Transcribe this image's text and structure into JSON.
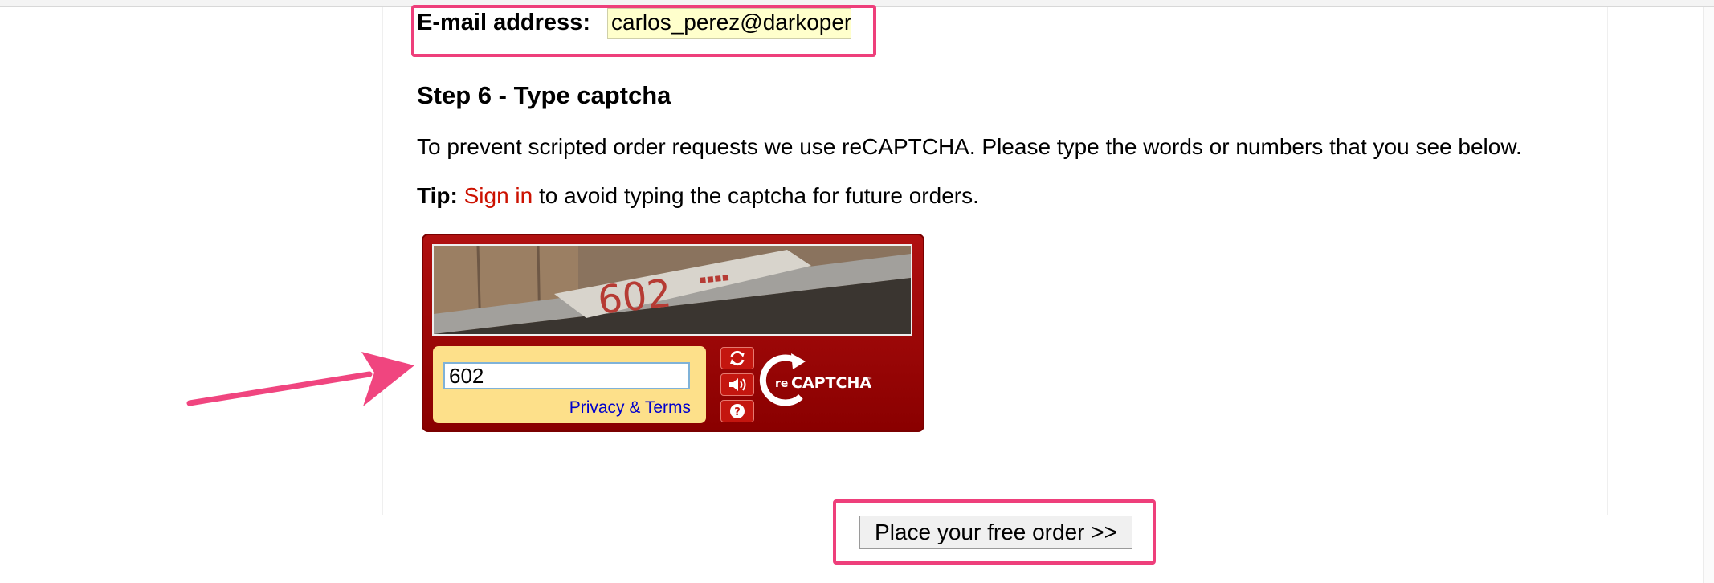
{
  "form": {
    "email_label": "E-mail address:",
    "email_value": "carlos_perez@darkopera",
    "step_title": "Step 6 - Type captcha",
    "description": "To prevent scripted order requests we use reCAPTCHA. Please type the words or numbers that you see below.",
    "tip_label": "Tip:",
    "tip_link": "Sign in",
    "tip_rest": " to avoid typing the captcha for future orders."
  },
  "captcha": {
    "image_text": "602",
    "answer_value": "602",
    "privacy_link": "Privacy & Terms",
    "reload_icon": "refresh-icon",
    "audio_icon": "speaker-icon",
    "help_icon": "help-icon",
    "logo_text": "reCAPTCHA"
  },
  "order": {
    "button_label": "Place your free order >>"
  },
  "colors": {
    "highlight": "#ee3f7b",
    "link": "#cc1100",
    "captcha_red": "#a00000"
  }
}
